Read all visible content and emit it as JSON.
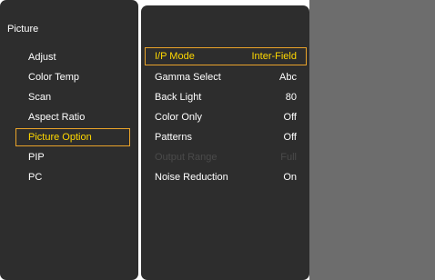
{
  "menu": {
    "title": "Picture",
    "categories": [
      {
        "label": "Adjust"
      },
      {
        "label": "Color Temp"
      },
      {
        "label": "Scan"
      },
      {
        "label": "Aspect Ratio"
      },
      {
        "label": "Picture Option"
      },
      {
        "label": "PIP"
      },
      {
        "label": "PC"
      }
    ],
    "selected_category": "Picture Option"
  },
  "options": [
    {
      "label": "I/P Mode",
      "value": "Inter-Field"
    },
    {
      "label": "Gamma Select",
      "value": "Abc"
    },
    {
      "label": "Back Light",
      "value": "80"
    },
    {
      "label": "Color Only",
      "value": "Off"
    },
    {
      "label": "Patterns",
      "value": "Off"
    },
    {
      "label": "Output Range",
      "value": "Full"
    },
    {
      "label": "Noise Reduction",
      "value": "On"
    }
  ],
  "colors": {
    "panel_bg": "#2d2d2d",
    "background_right": "#6d6d6d",
    "text": "#ffffff",
    "highlight_text": "#ffd800",
    "highlight_border": "#e9a32a",
    "disabled_text": "#4a4a4a"
  }
}
